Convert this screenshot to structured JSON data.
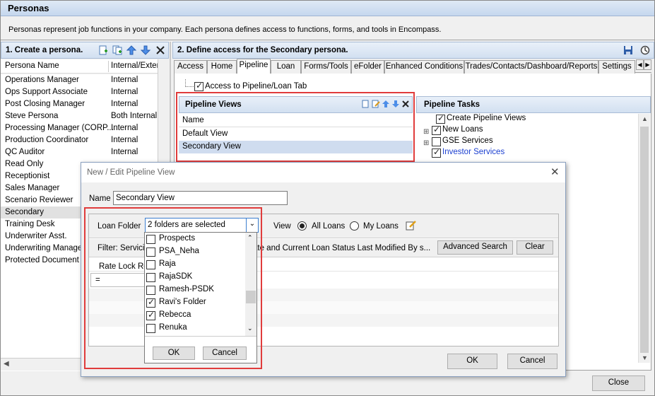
{
  "window": {
    "title": "Personas",
    "description": "Personas represent job functions in your company. Each persona defines access to functions, forms, and tools in Encompass."
  },
  "left_panel": {
    "header": "1. Create a persona.",
    "col_name": "Persona Name",
    "col_access": "Internal/Exter",
    "personas": [
      {
        "name": "Operations Manager",
        "access": "Internal"
      },
      {
        "name": "Ops Support Associate",
        "access": "Internal"
      },
      {
        "name": "Post Closing Manager",
        "access": "Internal"
      },
      {
        "name": "Steve Persona",
        "access": "Both Internal a"
      },
      {
        "name": "Processing Manager (CORP...",
        "access": "Internal"
      },
      {
        "name": "Production Coordinator",
        "access": "Internal"
      },
      {
        "name": "QC Auditor",
        "access": "Internal"
      },
      {
        "name": "Read Only",
        "access": ""
      },
      {
        "name": "Receptionist",
        "access": ""
      },
      {
        "name": "Sales Manager",
        "access": ""
      },
      {
        "name": "Scenario Reviewer",
        "access": ""
      },
      {
        "name": "Secondary",
        "access": ""
      },
      {
        "name": "Training Desk",
        "access": ""
      },
      {
        "name": "Underwriter Asst.",
        "access": ""
      },
      {
        "name": "Underwriting Manager",
        "access": ""
      },
      {
        "name": "Protected Document",
        "access": ""
      }
    ]
  },
  "right_panel": {
    "header": "2. Define access for the Secondary persona.",
    "tabs": [
      "Access",
      "Home",
      "Pipeline",
      "Loan",
      "Forms/Tools",
      "eFolder",
      "Enhanced Conditions",
      "Trades/Contacts/Dashboard/Reports",
      "Settings"
    ],
    "access_checkbox": "Access to Pipeline/Loan Tab",
    "pipeline_views": {
      "title": "Pipeline Views",
      "column": "Name",
      "items": [
        "Default View",
        "Secondary View"
      ]
    },
    "pipeline_tasks": {
      "title": "Pipeline Tasks",
      "items": [
        "Create Pipeline Views",
        "New Loans",
        "GSE Services",
        "Investor Services"
      ]
    }
  },
  "dialog": {
    "title": "New / Edit Pipeline View",
    "name_label": "Name",
    "name_value": "Secondary View",
    "loan_folder_label": "Loan Folder",
    "loan_folder_value": "2 folders are selected",
    "view_label": "View",
    "all_loans": "All Loans",
    "my_loans": "My Loans",
    "filter_text": "Filter: Servicin",
    "filter_text2": "ate  and  Current Loan Status Last Modified By s...",
    "advanced_search": "Advanced Search",
    "clear": "Clear",
    "rate_lock": "Rate Lock Re",
    "operator": "=",
    "folders": [
      {
        "name": "Prospects",
        "checked": false
      },
      {
        "name": "PSA_Neha",
        "checked": false
      },
      {
        "name": "Raja",
        "checked": false
      },
      {
        "name": "RajaSDK",
        "checked": false
      },
      {
        "name": "Ramesh-PSDK",
        "checked": false
      },
      {
        "name": "Ravi's Folder",
        "checked": true
      },
      {
        "name": "Rebecca",
        "checked": true
      },
      {
        "name": "Renuka",
        "checked": false
      }
    ],
    "dd_ok": "OK",
    "dd_cancel": "Cancel",
    "ok": "OK",
    "cancel": "Cancel"
  },
  "close_button": "Close"
}
